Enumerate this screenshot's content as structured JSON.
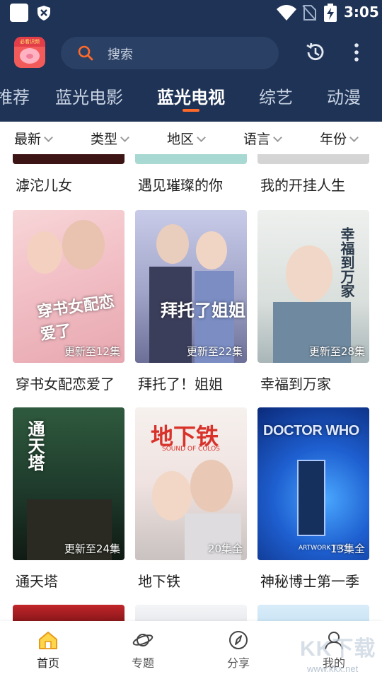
{
  "status_bar": {
    "time": "3:05"
  },
  "header": {
    "logo_text": "必看识频",
    "search_placeholder": "搜索"
  },
  "tabs": [
    {
      "label": "推荐",
      "active": false
    },
    {
      "label": "蓝光电影",
      "active": false
    },
    {
      "label": "蓝光电视",
      "active": true
    },
    {
      "label": "综艺",
      "active": false
    },
    {
      "label": "动漫",
      "active": false
    }
  ],
  "filters": [
    {
      "label": "最新"
    },
    {
      "label": "类型"
    },
    {
      "label": "地区"
    },
    {
      "label": "语言"
    },
    {
      "label": "年份"
    }
  ],
  "rows": [
    [
      {
        "title": "滹沱儿女",
        "badge": ""
      },
      {
        "title": "遇见璀璨的你",
        "badge": ""
      },
      {
        "title": "我的开挂人生",
        "badge": ""
      }
    ],
    [
      {
        "title": "穿书女配恋爱了",
        "badge": "更新至12集",
        "poster_text": "穿书女配恋爱了"
      },
      {
        "title": "拜托了！姐姐",
        "badge": "更新至22集",
        "poster_text": "拜托了姐姐"
      },
      {
        "title": "幸福到万家",
        "badge": "更新至28集",
        "poster_text": "幸福到万家"
      }
    ],
    [
      {
        "title": "通天塔",
        "badge": "更新至24集",
        "poster_text": "通天塔"
      },
      {
        "title": "地下铁",
        "badge": "20集全",
        "poster_text": "地下铁",
        "poster_sub": "SOUND OF COLOS"
      },
      {
        "title": "神秘博士第一季",
        "badge": "13集全",
        "poster_text": "DOCTOR WHO",
        "poster_sub": "ARTWORK TBC"
      }
    ]
  ],
  "bottom_nav": [
    {
      "label": "首页",
      "icon": "home-icon",
      "active": true
    },
    {
      "label": "专题",
      "icon": "planet-icon",
      "active": false
    },
    {
      "label": "分享",
      "icon": "compass-icon",
      "active": false
    },
    {
      "label": "我的",
      "icon": "user-icon",
      "active": false
    }
  ],
  "watermark": {
    "text": "KK下载",
    "url": "www.kkx.net"
  },
  "colors": {
    "header_bg": "#1e3355",
    "accent": "#ff6a2a",
    "search_bg": "#2a4064"
  }
}
